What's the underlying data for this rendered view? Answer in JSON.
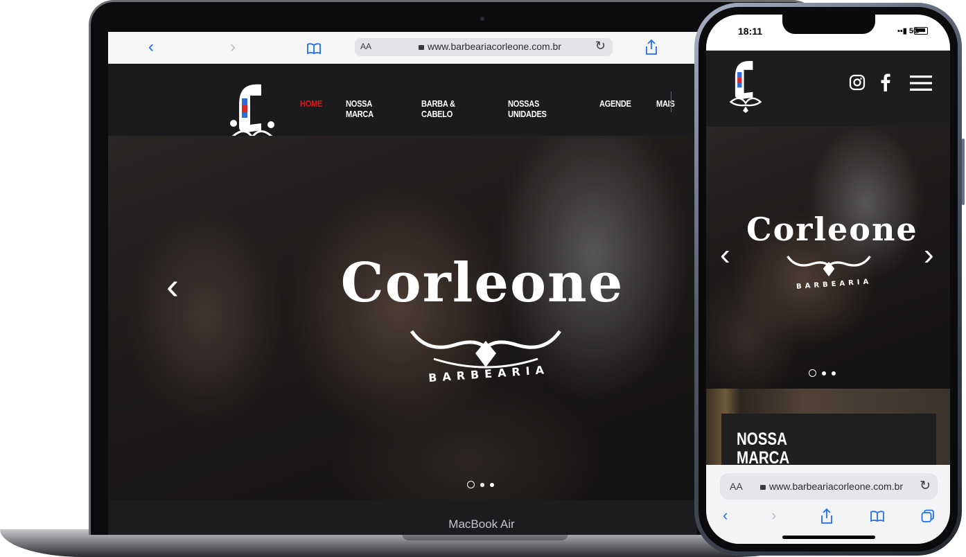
{
  "laptop": {
    "device_label": "MacBook Air",
    "browser": {
      "back_glyph": "‹",
      "forward_glyph": "›",
      "bookmarks_glyph": "📖",
      "text_size_label": "AA",
      "url": "www.barbeariacorleone.com.br",
      "reload_glyph": "↻",
      "share_glyph": "⇪"
    },
    "site": {
      "nav": [
        {
          "label": "HOME",
          "active": true
        },
        {
          "label": "NOSSA MARCA",
          "active": false
        },
        {
          "label": "BARBA & CABELO",
          "active": false
        },
        {
          "label": "NOSSAS UNIDADES",
          "active": false
        },
        {
          "label": "AGENDE",
          "active": false
        },
        {
          "label": "MAIS",
          "active": false
        }
      ],
      "hero": {
        "brand_name": "Corleone",
        "brand_tagline": "BARBEARIA",
        "prev_glyph": "‹",
        "slide_count": 3,
        "active_slide": 1
      }
    }
  },
  "phone": {
    "status": {
      "time": "18:11",
      "network": "5G"
    },
    "site": {
      "hero": {
        "brand_name": "Corleone",
        "brand_tagline": "BARBEARIA",
        "prev_glyph": "‹",
        "next_glyph": "›",
        "slide_count": 3,
        "active_slide": 1
      },
      "section_title": "NOSSA MARCA"
    },
    "browser": {
      "text_size_label": "AA",
      "url": "www.barbeariacorleone.com.br",
      "reload_glyph": "↻",
      "back_glyph": "‹",
      "forward_glyph": "›"
    }
  },
  "colors": {
    "accent_red": "#d41b1b",
    "ios_blue": "#1e6ef0",
    "site_dark": "#1b1b1d"
  }
}
